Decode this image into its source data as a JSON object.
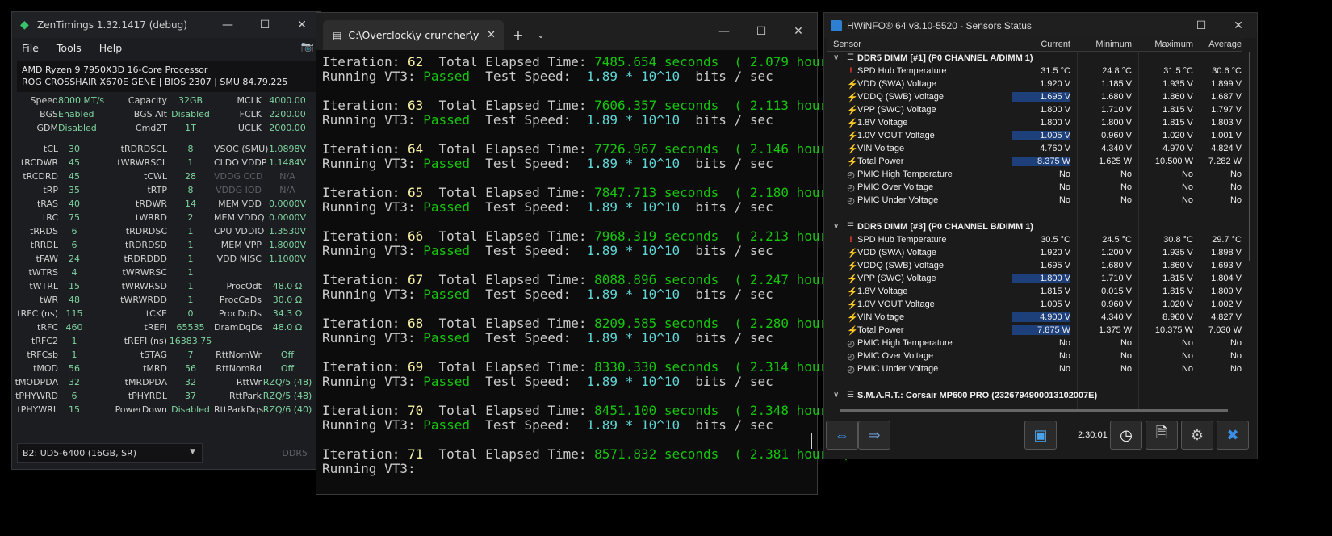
{
  "zentimings": {
    "title": "ZenTimings 1.32.1417 (debug)",
    "menu": [
      "File",
      "Tools",
      "Help"
    ],
    "cpu": "AMD Ryzen 9 7950X3D 16-Core Processor",
    "board": "ROG CROSSHAIR X670E GENE | BIOS 2307 | SMU 84.79.225",
    "rows": [
      [
        {
          "l": "Speed",
          "v": "8000 MT/s"
        },
        {
          "l": "Capacity",
          "v": "32GB"
        },
        {
          "l": "MCLK",
          "v": "4000.00"
        }
      ],
      [
        {
          "l": "BGS",
          "v": "Enabled"
        },
        {
          "l": "BGS Alt",
          "v": "Disabled"
        },
        {
          "l": "FCLK",
          "v": "2200.00"
        }
      ],
      [
        {
          "l": "GDM",
          "v": "Disabled"
        },
        {
          "l": "Cmd2T",
          "v": "1T"
        },
        {
          "l": "UCLK",
          "v": "2000.00"
        }
      ],
      null,
      [
        {
          "l": "tCL",
          "v": "30"
        },
        {
          "l": "tRDRDSCL",
          "v": "8"
        },
        {
          "l": "VSOC (SMU)",
          "v": "1.0898V"
        }
      ],
      [
        {
          "l": "tRCDWR",
          "v": "45"
        },
        {
          "l": "tWRWRSCL",
          "v": "1"
        },
        {
          "l": "CLDO VDDP",
          "v": "1.1484V"
        }
      ],
      [
        {
          "l": "tRCDRD",
          "v": "45"
        },
        {
          "l": "tCWL",
          "v": "28"
        },
        {
          "l": "VDDG CCD",
          "v": "N/A",
          "dis": true
        }
      ],
      [
        {
          "l": "tRP",
          "v": "35"
        },
        {
          "l": "tRTP",
          "v": "8"
        },
        {
          "l": "VDDG IOD",
          "v": "N/A",
          "dis": true
        }
      ],
      [
        {
          "l": "tRAS",
          "v": "40"
        },
        {
          "l": "tRDWR",
          "v": "14"
        },
        {
          "l": "MEM VDD",
          "v": "0.0000V"
        }
      ],
      [
        {
          "l": "tRC",
          "v": "75"
        },
        {
          "l": "tWRRD",
          "v": "2"
        },
        {
          "l": "MEM VDDQ",
          "v": "0.0000V"
        }
      ],
      [
        {
          "l": "tRRDS",
          "v": "6"
        },
        {
          "l": "tRDRDSC",
          "v": "1"
        },
        {
          "l": "CPU VDDIO",
          "v": "1.3530V"
        }
      ],
      [
        {
          "l": "tRRDL",
          "v": "6"
        },
        {
          "l": "tRDRDSD",
          "v": "1"
        },
        {
          "l": "MEM VPP",
          "v": "1.8000V"
        }
      ],
      [
        {
          "l": "tFAW",
          "v": "24"
        },
        {
          "l": "tRDRDDD",
          "v": "1"
        },
        {
          "l": "VDD MISC",
          "v": "1.1000V"
        }
      ],
      [
        {
          "l": "tWTRS",
          "v": "4"
        },
        {
          "l": "tWRWRSC",
          "v": "1"
        },
        {
          "l": "",
          "v": ""
        }
      ],
      [
        {
          "l": "tWTRL",
          "v": "15"
        },
        {
          "l": "tWRWRSD",
          "v": "1"
        },
        {
          "l": "ProcOdt",
          "v": "48.0 Ω"
        }
      ],
      [
        {
          "l": "tWR",
          "v": "48"
        },
        {
          "l": "tWRWRDD",
          "v": "1"
        },
        {
          "l": "ProcCaDs",
          "v": "30.0 Ω"
        }
      ],
      [
        {
          "l": "tRFC (ns)",
          "v": "115"
        },
        {
          "l": "tCKE",
          "v": "0"
        },
        {
          "l": "ProcDqDs",
          "v": "34.3 Ω"
        }
      ],
      [
        {
          "l": "tRFC",
          "v": "460"
        },
        {
          "l": "tREFI",
          "v": "65535"
        },
        {
          "l": "DramDqDs",
          "v": "48.0 Ω"
        }
      ],
      [
        {
          "l": "tRFC2",
          "v": "1"
        },
        {
          "l": "tREFI (ns)",
          "v": "16383.75"
        },
        {
          "l": "",
          "v": ""
        }
      ],
      [
        {
          "l": "tRFCsb",
          "v": "1"
        },
        {
          "l": "tSTAG",
          "v": "7"
        },
        {
          "l": "RttNomWr",
          "v": "Off"
        }
      ],
      [
        {
          "l": "tMOD",
          "v": "56"
        },
        {
          "l": "tMRD",
          "v": "56"
        },
        {
          "l": "RttNomRd",
          "v": "Off"
        }
      ],
      [
        {
          "l": "tMODPDA",
          "v": "32"
        },
        {
          "l": "tMRDPDA",
          "v": "32"
        },
        {
          "l": "RttWr",
          "v": "RZQ/5 (48)"
        }
      ],
      [
        {
          "l": "tPHYWRD",
          "v": "6"
        },
        {
          "l": "tPHYRDL",
          "v": "37"
        },
        {
          "l": "RttPark",
          "v": "RZQ/5 (48)"
        }
      ],
      [
        {
          "l": "tPHYWRL",
          "v": "15"
        },
        {
          "l": "PowerDown",
          "v": "Disabled"
        },
        {
          "l": "RttParkDqs",
          "v": "RZQ/6 (40)"
        }
      ]
    ],
    "dimm_select": "B2: UD5-6400 (16GB, SR)",
    "ddr_label": "DDR5"
  },
  "terminal": {
    "tab_title": "C:\\Overclock\\y-cruncher\\y-cru",
    "iterations": [
      {
        "n": "62",
        "sec": "7485.654",
        "hrs": "2.079"
      },
      {
        "n": "63",
        "sec": "7606.357",
        "hrs": "2.113"
      },
      {
        "n": "64",
        "sec": "7726.967",
        "hrs": "2.146"
      },
      {
        "n": "65",
        "sec": "7847.713",
        "hrs": "2.180"
      },
      {
        "n": "66",
        "sec": "7968.319",
        "hrs": "2.213"
      },
      {
        "n": "67",
        "sec": "8088.896",
        "hrs": "2.247"
      },
      {
        "n": "68",
        "sec": "8209.585",
        "hrs": "2.280"
      },
      {
        "n": "69",
        "sec": "8330.330",
        "hrs": "2.314"
      },
      {
        "n": "70",
        "sec": "8451.100",
        "hrs": "2.348"
      }
    ],
    "last_iteration": {
      "n": "71",
      "sec": "8571.832",
      "hrs": "2.381"
    },
    "txt_iteration": "Iteration:",
    "txt_total": "Total Elapsed Time:",
    "txt_seconds": "seconds",
    "txt_hours": "hours",
    "txt_running": "Running VT3:",
    "txt_passed": "Passed",
    "txt_speed_label": "Test Speed:",
    "txt_speed_val": "1.89 * 10^10",
    "txt_speed_unit": "bits / sec"
  },
  "hwinfo": {
    "title": "HWiNFO® 64 v8.10-5520 - Sensors Status",
    "headers": [
      "Sensor",
      "Current",
      "Minimum",
      "Maximum",
      "Average"
    ],
    "groups": [
      {
        "name": "DDR5 DIMM [#1] (P0 CHANNEL A/DIMM 1)",
        "rows": [
          {
            "icon": "warn",
            "name": "SPD Hub Temperature",
            "cur": "31.5 °C",
            "min": "24.8 °C",
            "max": "31.5 °C",
            "avg": "30.6 °C"
          },
          {
            "icon": "bolt",
            "name": "VDD (SWA) Voltage",
            "cur": "1.920 V",
            "min": "1.185 V",
            "max": "1.935 V",
            "avg": "1.899 V"
          },
          {
            "icon": "bolt",
            "name": "VDDQ (SWB) Voltage",
            "cur": "1.695 V",
            "min": "1.680 V",
            "max": "1.860 V",
            "avg": "1.687 V",
            "hl": true
          },
          {
            "icon": "bolt",
            "name": "VPP (SWC) Voltage",
            "cur": "1.800 V",
            "min": "1.710 V",
            "max": "1.815 V",
            "avg": "1.797 V"
          },
          {
            "icon": "bolt",
            "name": "1.8V Voltage",
            "cur": "1.800 V",
            "min": "1.800 V",
            "max": "1.815 V",
            "avg": "1.803 V"
          },
          {
            "icon": "bolt",
            "name": "1.0V VOUT Voltage",
            "cur": "1.005 V",
            "min": "0.960 V",
            "max": "1.020 V",
            "avg": "1.001 V",
            "hl": true
          },
          {
            "icon": "bolt",
            "name": "VIN Voltage",
            "cur": "4.760 V",
            "min": "4.340 V",
            "max": "4.970 V",
            "avg": "4.824 V"
          },
          {
            "icon": "bolt",
            "name": "Total Power",
            "cur": "8.375 W",
            "min": "1.625 W",
            "max": "10.500 W",
            "avg": "7.282 W",
            "hl": true
          },
          {
            "icon": "clk",
            "name": "PMIC High Temperature",
            "cur": "No",
            "min": "No",
            "max": "No",
            "avg": "No"
          },
          {
            "icon": "clk",
            "name": "PMIC Over Voltage",
            "cur": "No",
            "min": "No",
            "max": "No",
            "avg": "No"
          },
          {
            "icon": "clk",
            "name": "PMIC Under Voltage",
            "cur": "No",
            "min": "No",
            "max": "No",
            "avg": "No"
          }
        ]
      },
      {
        "name": "DDR5 DIMM [#3] (P0 CHANNEL B/DIMM 1)",
        "rows": [
          {
            "icon": "warn",
            "name": "SPD Hub Temperature",
            "cur": "30.5 °C",
            "min": "24.5 °C",
            "max": "30.8 °C",
            "avg": "29.7 °C"
          },
          {
            "icon": "bolt",
            "name": "VDD (SWA) Voltage",
            "cur": "1.920 V",
            "min": "1.200 V",
            "max": "1.935 V",
            "avg": "1.898 V"
          },
          {
            "icon": "bolt",
            "name": "VDDQ (SWB) Voltage",
            "cur": "1.695 V",
            "min": "1.680 V",
            "max": "1.860 V",
            "avg": "1.693 V"
          },
          {
            "icon": "bolt",
            "name": "VPP (SWC) Voltage",
            "cur": "1.800 V",
            "min": "1.710 V",
            "max": "1.815 V",
            "avg": "1.804 V",
            "hl": true
          },
          {
            "icon": "bolt",
            "name": "1.8V Voltage",
            "cur": "1.815 V",
            "min": "0.015 V",
            "max": "1.815 V",
            "avg": "1.809 V"
          },
          {
            "icon": "bolt",
            "name": "1.0V VOUT Voltage",
            "cur": "1.005 V",
            "min": "0.960 V",
            "max": "1.020 V",
            "avg": "1.002 V"
          },
          {
            "icon": "bolt",
            "name": "VIN Voltage",
            "cur": "4.900 V",
            "min": "4.340 V",
            "max": "8.960 V",
            "avg": "4.827 V",
            "hl": true
          },
          {
            "icon": "bolt",
            "name": "Total Power",
            "cur": "7.875 W",
            "min": "1.375 W",
            "max": "10.375 W",
            "avg": "7.030 W",
            "hl": true
          },
          {
            "icon": "clk",
            "name": "PMIC High Temperature",
            "cur": "No",
            "min": "No",
            "max": "No",
            "avg": "No"
          },
          {
            "icon": "clk",
            "name": "PMIC Over Voltage",
            "cur": "No",
            "min": "No",
            "max": "No",
            "avg": "No"
          },
          {
            "icon": "clk",
            "name": "PMIC Under Voltage",
            "cur": "No",
            "min": "No",
            "max": "No",
            "avg": "No"
          }
        ]
      },
      {
        "name": "S.M.A.R.T.: Corsair MP600 PRO (2326794900013102007E)",
        "rows": []
      }
    ],
    "timer": "2:30:01"
  },
  "icons": {
    "zt_app": "zentimings-app-icon",
    "camera": "camera-icon",
    "terminal_tab": "terminal-icon",
    "hw_nav": "arrows-icon",
    "hw_net": "network-icon",
    "hw_clock": "clock-icon",
    "hw_report": "report-add-icon",
    "hw_settings": "gear-icon",
    "hw_close": "close-icon"
  }
}
